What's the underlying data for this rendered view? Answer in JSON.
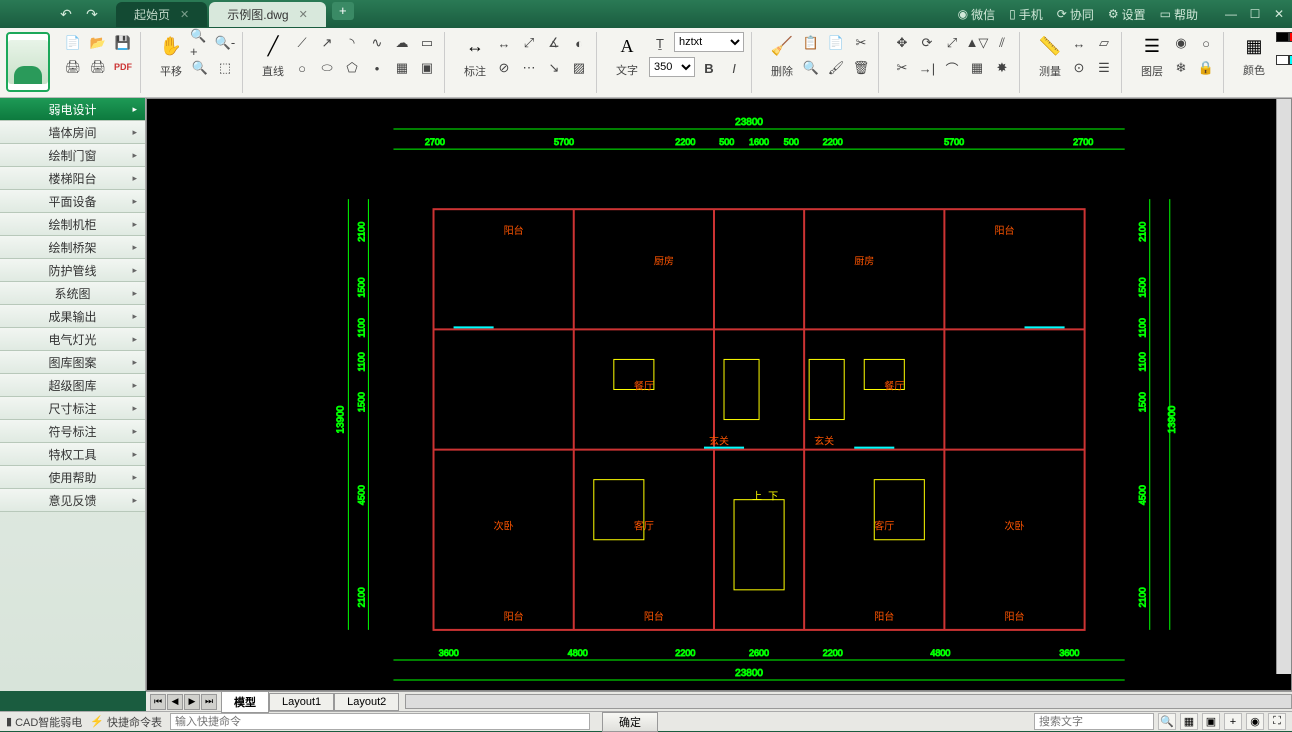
{
  "titlebar": {
    "tabs": [
      {
        "label": "起始页",
        "active": false
      },
      {
        "label": "示例图.dwg",
        "active": true
      }
    ],
    "right": {
      "wechat": "微信",
      "mobile": "手机",
      "collab": "协同",
      "settings": "设置",
      "help": "帮助"
    }
  },
  "ribbon": {
    "pan_label": "平移",
    "line_label": "直线",
    "annotate_label": "标注",
    "text_label": "文字",
    "font_value": "hztxt",
    "size_value": "350",
    "bold": "B",
    "italic": "I",
    "delete_label": "删除",
    "measure_label": "测量",
    "layer_label": "图层",
    "color_label": "颜色"
  },
  "sidebar": {
    "items": [
      {
        "label": "弱电设计",
        "active": true
      },
      {
        "label": "墙体房间"
      },
      {
        "label": "绘制门窗"
      },
      {
        "label": "楼梯阳台"
      },
      {
        "label": "平面设备"
      },
      {
        "label": "绘制机柜"
      },
      {
        "label": "绘制桥架"
      },
      {
        "label": "防护管线"
      },
      {
        "label": "系统图"
      },
      {
        "label": "成果输出"
      },
      {
        "label": "电气灯光"
      },
      {
        "label": "图库图案"
      },
      {
        "label": "超级图库"
      },
      {
        "label": "尺寸标注"
      },
      {
        "label": "符号标注"
      },
      {
        "label": "特权工具"
      },
      {
        "label": "使用帮助"
      },
      {
        "label": "意见反馈"
      }
    ]
  },
  "drawing": {
    "total_width": "23800",
    "top_dims": [
      "2700",
      "5700",
      "2200",
      "500",
      "1600",
      "500",
      "2200",
      "5700",
      "2700"
    ],
    "bottom_dims": [
      "3600",
      "4800",
      "2200",
      "2600",
      "2200",
      "4800",
      "3600"
    ],
    "left_total": "13900",
    "left_dims": [
      "2100",
      "1500",
      "1100",
      "1100",
      "1500",
      "4500",
      "2100"
    ],
    "right_total": "13900",
    "right_dims": [
      "2100",
      "1500",
      "1100",
      "1100",
      "1500",
      "4500",
      "2100"
    ],
    "rooms": {
      "balcony": "阳台",
      "kitchen": "厨房",
      "dining": "餐厅",
      "foyer": "玄关",
      "bedroom2": "次卧",
      "living": "客厅",
      "up": "上",
      "down": "下"
    }
  },
  "sheets": {
    "tabs": [
      "模型",
      "Layout1",
      "Layout2"
    ]
  },
  "bottombar": {
    "app_label": "CAD智能弱电",
    "cmd_table": "快捷命令表",
    "cmd_placeholder": "输入快捷命令",
    "ok": "确定",
    "search_placeholder": "搜索文字"
  }
}
